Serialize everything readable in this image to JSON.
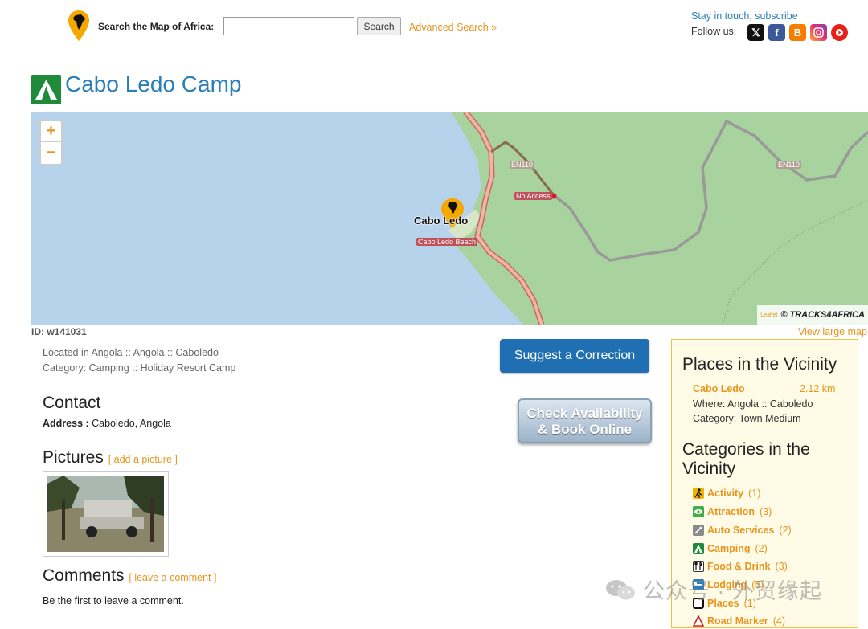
{
  "header": {
    "search_label": "Search the Map of Africa:",
    "search_value": "",
    "search_button": "Search",
    "advanced_search": "Advanced Search »",
    "stay_in_touch": "Stay in touch, subscribe",
    "follow_us": "Follow us:",
    "social_icons": [
      "x-icon",
      "facebook-icon",
      "blogger-icon",
      "instagram-icon",
      "youtube-icon"
    ]
  },
  "page": {
    "title": "Cabo Ledo Camp",
    "title_icon": "camping-tent-icon",
    "id_label": "ID: w141031",
    "view_large_map": "View large map",
    "located": "Located in Angola :: Angola  :: Caboledo",
    "category": "Category: Camping :: Holiday Resort Camp",
    "contact_heading": "Contact",
    "address_label": "Address :",
    "address_value": " Caboledo, Angola",
    "pictures_heading": "Pictures",
    "add_picture": "[ add a picture ]",
    "comments_heading": "Comments",
    "leave_comment": "[ leave a comment ]",
    "first_comment": "Be the first to leave a comment.",
    "suggest_button": "Suggest a Correction",
    "book_button_line1": "Check Availability",
    "book_button_line2": "& Book Online"
  },
  "map": {
    "zoom_in": "+",
    "zoom_out": "−",
    "marker_label": "Cabo Ledo",
    "road_label_1": "EN110",
    "road_label_2": "EN110",
    "no_access_label": "No Access",
    "beach_label": "Cabo Ledo Beach",
    "leaflet_attrib": "Leaflet",
    "tracks_attrib": "© TRACKS4AFRICA",
    "colors": {
      "water": "#b7d3ec",
      "land": "#a9d39e",
      "road_main": "#e8a098",
      "road_track": "#999999"
    }
  },
  "sidebar": {
    "vicinity_heading": "Places in the Vicinity",
    "vicinity_item": {
      "name": "Cabo Ledo",
      "distance": "2.12 km",
      "where": "Where: Angola :: Caboledo",
      "category": "Category: Town Medium"
    },
    "categories_heading": "Categories in the Vicinity",
    "categories": [
      {
        "label": "Activity",
        "count": "(1)",
        "icon": "activity-icon"
      },
      {
        "label": "Attraction",
        "count": "(3)",
        "icon": "attraction-icon"
      },
      {
        "label": "Auto Services",
        "count": "(2)",
        "icon": "auto-services-icon"
      },
      {
        "label": "Camping",
        "count": "(2)",
        "icon": "camping-icon"
      },
      {
        "label": "Food & Drink",
        "count": "(3)",
        "icon": "food-drink-icon"
      },
      {
        "label": "Lodging",
        "count": "(5)",
        "icon": "lodging-icon"
      },
      {
        "label": "Places",
        "count": "(1)",
        "icon": "places-icon"
      },
      {
        "label": "Road Marker",
        "count": "(4)",
        "icon": "road-marker-icon"
      }
    ]
  },
  "watermark": {
    "text": "公众号 · 外贸缘起"
  }
}
